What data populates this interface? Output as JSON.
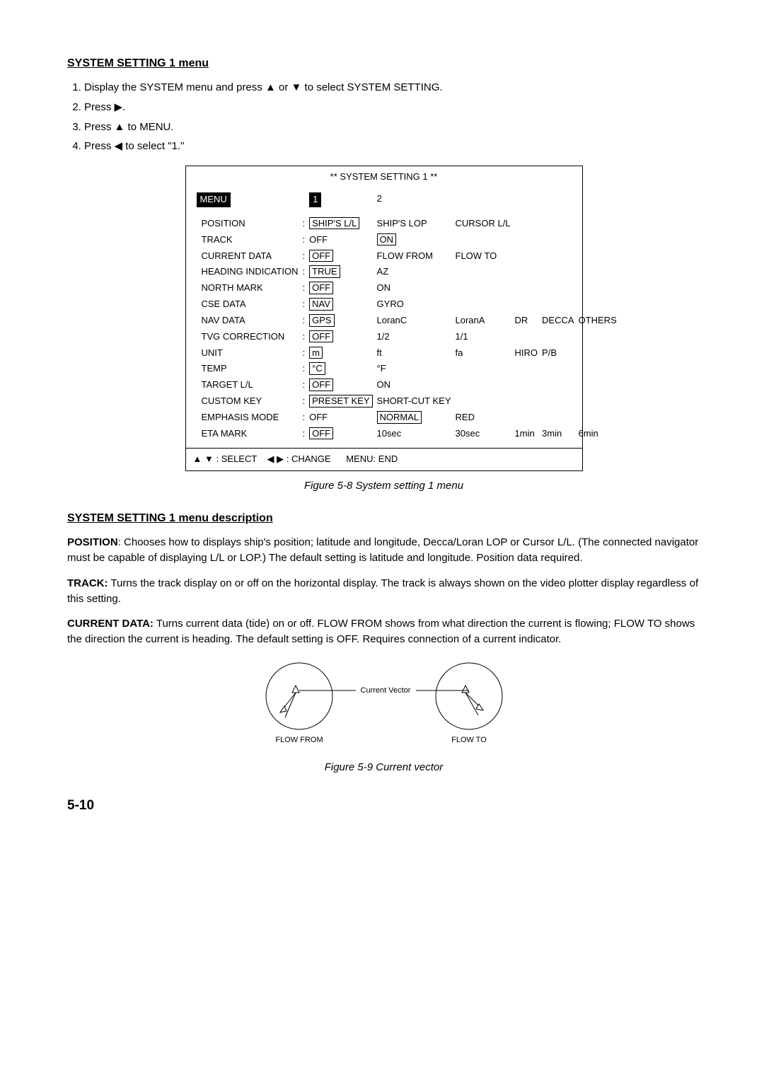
{
  "section1": {
    "heading": "SYSTEM SETTING 1 menu",
    "step1_a": "Display the SYSTEM menu and press ",
    "step1_b": " or ",
    "step1_c": " to select SYSTEM SETTING.",
    "step2_a": "Press ",
    "step2_b": ".",
    "step3_a": "Press ",
    "step3_b": " to MENU.",
    "step4_a": "Press ",
    "step4_b": " to select \"1.\""
  },
  "glyphs": {
    "up": "▲",
    "down": "▼",
    "left": "◀",
    "right": "▶"
  },
  "menu": {
    "title": "** SYSTEM SETTING 1 **",
    "tabs": {
      "menu": "MENU",
      "t1": "1",
      "t2": "2"
    },
    "rows": [
      {
        "label": "POSITION",
        "opts": [
          "SHIP'S L/L",
          "SHIP'S LOP",
          "CURSOR L/L"
        ],
        "sel": 0
      },
      {
        "label": "TRACK",
        "opts": [
          "OFF",
          "ON"
        ],
        "sel": 1
      },
      {
        "label": "CURRENT DATA",
        "opts": [
          "OFF",
          "FLOW FROM",
          "FLOW TO"
        ],
        "sel": 0
      },
      {
        "label": "HEADING INDICATION",
        "opts": [
          "TRUE",
          "AZ"
        ],
        "sel": 0
      },
      {
        "label": "NORTH MARK",
        "opts": [
          "OFF",
          "ON"
        ],
        "sel": 0
      },
      {
        "label": "CSE DATA",
        "opts": [
          "NAV",
          "GYRO"
        ],
        "sel": 0
      },
      {
        "label": "NAV DATA",
        "opts": [
          "GPS",
          "LoranC",
          "LoranA",
          "DR",
          "DECCA",
          "OTHERS"
        ],
        "sel": 0
      },
      {
        "label": "TVG CORRECTION",
        "opts": [
          "OFF",
          "1/2",
          "1/1"
        ],
        "sel": 0
      },
      {
        "label": "UNIT",
        "opts": [
          "m",
          "ft",
          "fa",
          "HIRO",
          "P/B"
        ],
        "sel": 0
      },
      {
        "label": "TEMP",
        "opts": [
          "°C",
          "°F"
        ],
        "sel": 0
      },
      {
        "label": "TARGET L/L",
        "opts": [
          "OFF",
          "ON"
        ],
        "sel": 0
      },
      {
        "label": "CUSTOM KEY",
        "opts": [
          "PRESET KEY",
          "SHORT-CUT KEY"
        ],
        "sel": 0
      },
      {
        "label": "EMPHASIS MODE",
        "opts": [
          "OFF",
          "NORMAL",
          "RED"
        ],
        "sel": 1
      },
      {
        "label": "ETA MARK",
        "opts": [
          "OFF",
          "10sec",
          "30sec",
          "1min",
          "3min",
          "6min"
        ],
        "sel": 0
      }
    ],
    "footer": {
      "select": ": SELECT",
      "change": ": CHANGE",
      "end": "MENU: END"
    }
  },
  "fig1": "Figure 5-8 System setting 1 menu",
  "section2": {
    "heading": "SYSTEM SETTING 1 menu description",
    "p1_label": "POSITION",
    "p1_text": ": Chooses how to displays ship's position; latitude and longitude, Decca/Loran LOP or Cursor L/L. (The connected navigator must be capable of displaying L/L or LOP.) The default setting is latitude and longitude. Position data required.",
    "p2_label": "TRACK:",
    "p2_text": " Turns the track display on or off on the horizontal display. The track is always shown on the video plotter display regardless of this setting.",
    "p3_label": "CURRENT DATA:",
    "p3_text": " Turns current data (tide) on or off. FLOW FROM shows from what direction the current is flowing; FLOW TO shows the direction the current is heading. The default setting is OFF. Requires connection of a current indicator."
  },
  "diagram": {
    "label_center": "Current Vector",
    "label_left": "FLOW FROM",
    "label_right": "FLOW TO"
  },
  "fig2": "Figure 5-9 Current vector",
  "page": "5-10"
}
